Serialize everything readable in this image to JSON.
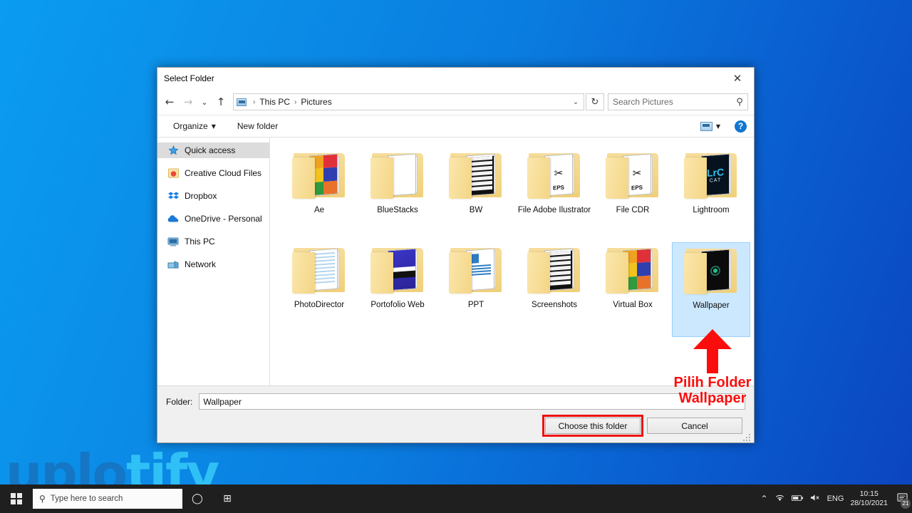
{
  "desktop": {
    "watermark_part1": "uplo",
    "watermark_part2": "tify",
    "bg_from": "#0a9cf0",
    "bg_to": "#0b44bf"
  },
  "dialog": {
    "title": "Select Folder",
    "close_label": "✕",
    "nav": {
      "back": "←",
      "forward": "→",
      "recent": "⌄",
      "up": "↑",
      "breadcrumb": [
        "This PC",
        "Pictures"
      ],
      "breadcrumb_sep": "›",
      "address_chevron": "⌄",
      "refresh": "↻"
    },
    "search": {
      "placeholder": "Search Pictures",
      "value": "",
      "icon": "search-icon"
    },
    "command_bar": {
      "organize": "Organize",
      "organize_caret": "▼",
      "new_folder": "New folder",
      "view_caret": "▼",
      "help": "?"
    },
    "nav_pane": [
      {
        "label": "Quick access",
        "icon": "star-icon",
        "selected": true
      },
      {
        "label": "Creative Cloud Files",
        "icon": "creative-cloud-icon",
        "selected": false
      },
      {
        "label": "Dropbox",
        "icon": "dropbox-icon",
        "selected": false
      },
      {
        "label": "OneDrive - Personal",
        "icon": "onedrive-cloud-icon",
        "selected": false
      },
      {
        "label": "This PC",
        "icon": "monitor-icon",
        "selected": false
      },
      {
        "label": "Network",
        "icon": "network-icon",
        "selected": false
      }
    ],
    "folders": [
      {
        "name": "Ae",
        "art": "grid",
        "selected": false
      },
      {
        "name": "BlueStacks",
        "art": "plain",
        "selected": false
      },
      {
        "name": "BW",
        "art": "news",
        "selected": false
      },
      {
        "name": "File Adobe Ilustrator",
        "art": "eps",
        "eps_label": "EPS",
        "selected": false
      },
      {
        "name": "File CDR",
        "art": "eps",
        "eps_label": "EPS",
        "selected": false
      },
      {
        "name": "Lightroom",
        "art": "lrc",
        "lrc_title": "LrC",
        "lrc_sub": "CAT",
        "selected": false
      },
      {
        "name": "PhotoDirector",
        "art": "lines",
        "selected": false
      },
      {
        "name": "Portofolio Web",
        "art": "blue",
        "selected": false
      },
      {
        "name": "PPT",
        "art": "doc",
        "selected": false
      },
      {
        "name": "Screenshots",
        "art": "news",
        "selected": false
      },
      {
        "name": "Virtual Box",
        "art": "grid",
        "selected": false
      },
      {
        "name": "Wallpaper",
        "art": "wall",
        "selected": true
      }
    ],
    "footer": {
      "folder_label": "Folder:",
      "folder_value": "Wallpaper",
      "choose_button": "Choose this folder",
      "cancel_button": "Cancel",
      "highlight_color": "#ee1111"
    }
  },
  "annotation": {
    "line1": "Pilih Folder",
    "line2": "Wallpaper",
    "color": "#fc0d0d",
    "arrow": "arrow-up"
  },
  "taskbar": {
    "search_placeholder": "Type here to search",
    "cortana": "◯",
    "task_view": "⊞",
    "tray": {
      "chevron": "⌃",
      "network": "🖧",
      "battery": "🔋",
      "volume": "🔇",
      "language": "ENG",
      "time": "10:15",
      "date": "28/10/2021",
      "notification_count": "21"
    }
  }
}
